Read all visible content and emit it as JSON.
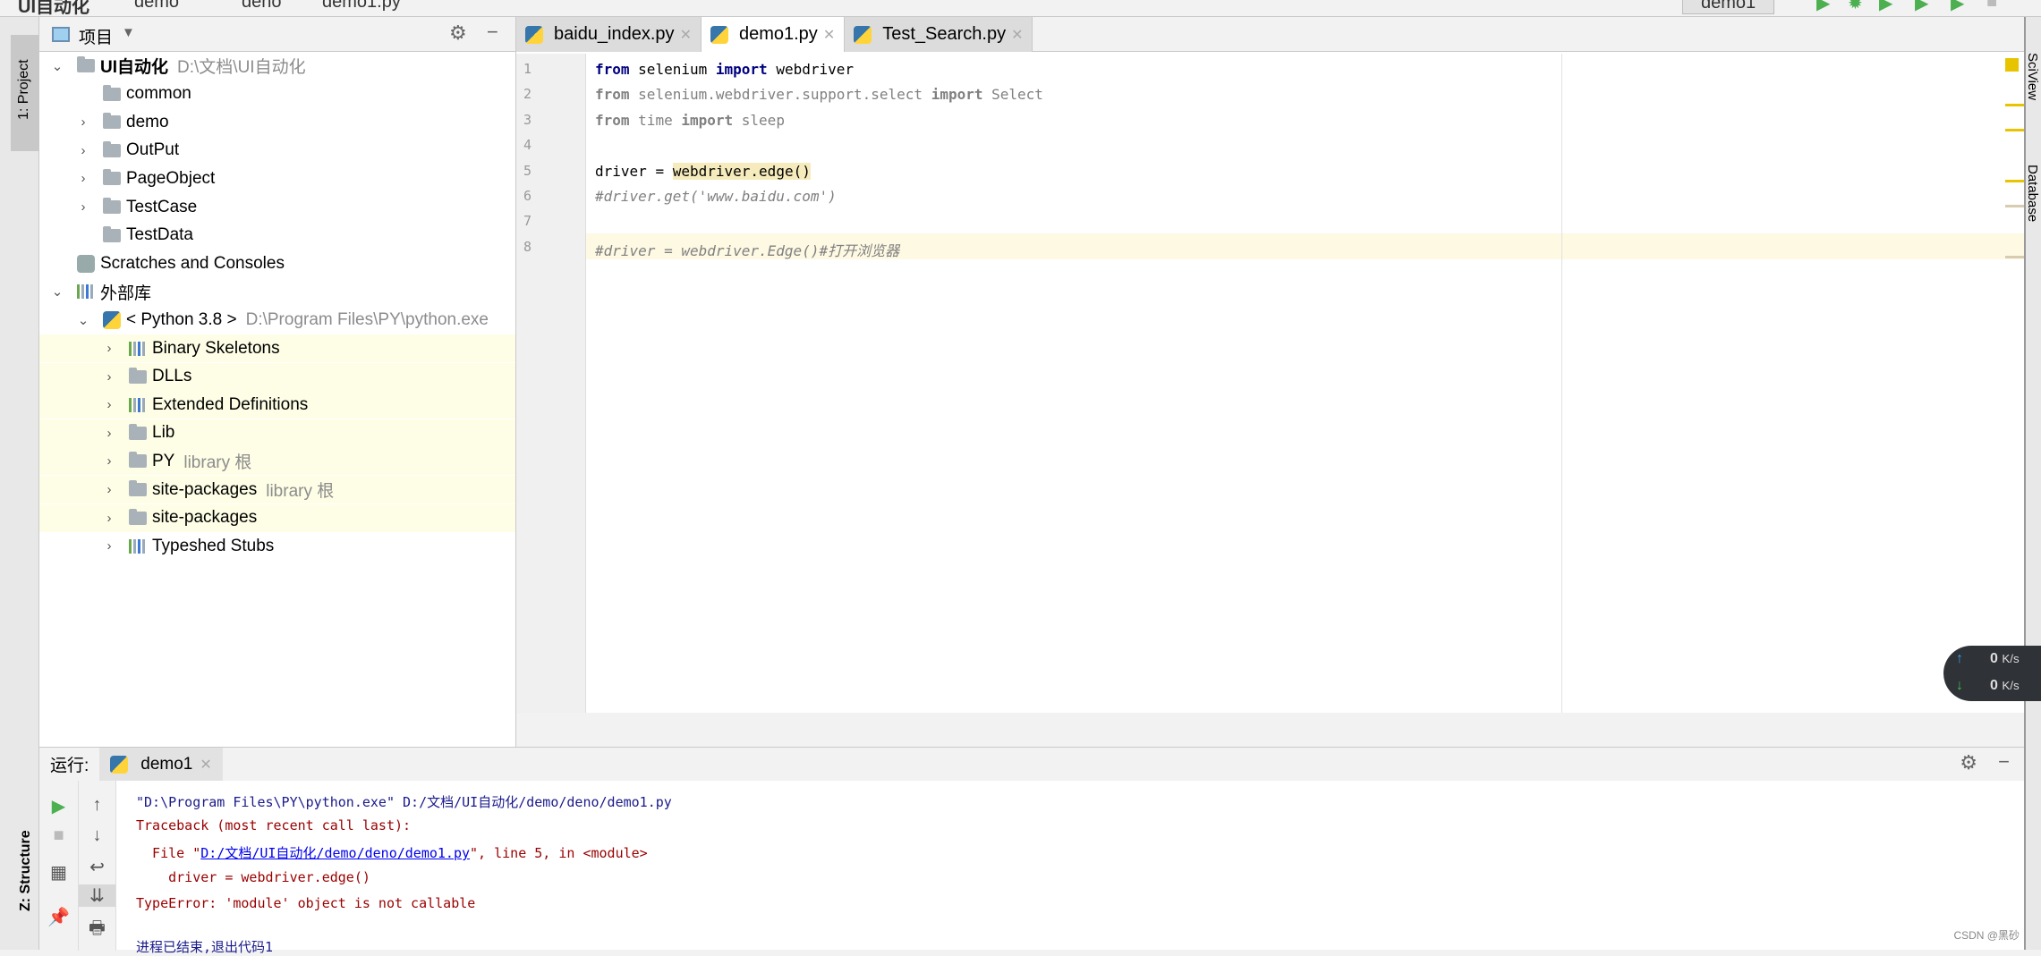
{
  "breadcrumb": [
    "UI自动化",
    "demo",
    "deno",
    "demo1.py"
  ],
  "run_config": "demo1",
  "left_strip": {
    "project_tab": "1: Project",
    "structure_tab": "Z: Structure"
  },
  "right_strip": {
    "sciview_tab": "SciView",
    "database_tab": "Database"
  },
  "project": {
    "title": "项目",
    "tree": [
      {
        "label": "UI自动化",
        "hint": "D:\\文档\\UI自动化",
        "icon": "folder-icon",
        "expanded": true,
        "bold": true,
        "depth": 0
      },
      {
        "label": "common",
        "icon": "folder-icon",
        "depth": 1,
        "leaf": true
      },
      {
        "label": "demo",
        "icon": "folder-icon",
        "depth": 1
      },
      {
        "label": "OutPut",
        "icon": "folder-icon",
        "depth": 1
      },
      {
        "label": "PageObject",
        "icon": "folder-icon",
        "depth": 1
      },
      {
        "label": "TestCase",
        "icon": "folder-icon",
        "depth": 1
      },
      {
        "label": "TestData",
        "icon": "folder-icon",
        "depth": 1,
        "leaf": true
      },
      {
        "label": "Scratches and Consoles",
        "icon": "scratches-icon",
        "depth": 0,
        "leaf": true
      },
      {
        "label": "外部库",
        "icon": "library-icon",
        "depth": 0,
        "expanded": true
      },
      {
        "label": "< Python 3.8 >",
        "hint": "D:\\Program Files\\PY\\python.exe",
        "icon": "python-icon",
        "depth": 1,
        "expanded": true
      },
      {
        "label": "Binary Skeletons",
        "icon": "library-icon",
        "depth": 2,
        "lib": true
      },
      {
        "label": "DLLs",
        "icon": "folder-icon",
        "depth": 2,
        "lib": true
      },
      {
        "label": "Extended Definitions",
        "icon": "library-icon",
        "depth": 2,
        "lib": true
      },
      {
        "label": "Lib",
        "icon": "folder-icon",
        "depth": 2,
        "lib": true
      },
      {
        "label": "PY",
        "hint": "library 根",
        "icon": "folder-icon",
        "depth": 2,
        "lib": true
      },
      {
        "label": "site-packages",
        "hint": "library 根",
        "icon": "folder-icon",
        "depth": 2,
        "lib": true
      },
      {
        "label": "site-packages",
        "icon": "folder-icon",
        "depth": 2,
        "lib": true
      },
      {
        "label": "Typeshed Stubs",
        "icon": "library-icon",
        "depth": 2
      }
    ]
  },
  "editor": {
    "tabs": [
      {
        "label": "baidu_index.py"
      },
      {
        "label": "demo1.py",
        "active": true
      },
      {
        "label": "Test_Search.py"
      }
    ],
    "lines": [
      {
        "n": "1",
        "t": "from selenium import webdriver"
      },
      {
        "n": "2",
        "t": "from selenium.webdriver.support.select import Select"
      },
      {
        "n": "3",
        "t": "from time import sleep"
      },
      {
        "n": "4",
        "t": ""
      },
      {
        "n": "5",
        "t": "driver = webdriver.edge()"
      },
      {
        "n": "6",
        "t": "#driver.get('www.baidu.com')"
      },
      {
        "n": "7",
        "t": ""
      },
      {
        "n": "8",
        "t": "#driver = webdriver.Edge()#打开浏览器"
      }
    ]
  },
  "run": {
    "label": "运行:",
    "tab": "demo1",
    "output": {
      "cmd": "\"D:\\Program Files\\PY\\python.exe\" D:/文档/UI自动化/demo/deno/demo1.py",
      "traceback": "Traceback (most recent call last):",
      "file_prefix": "  File \"",
      "file_link": "D:/文档/UI自动化/demo/deno/demo1.py",
      "file_suffix": "\", line 5, in <module>",
      "code": "    driver = webdriver.edge()",
      "error": "TypeError: 'module' object is not callable",
      "exit": "进程已结束,退出代码1"
    }
  },
  "network": {
    "up": "0",
    "down": "0",
    "unit": "K/s"
  },
  "watermark": "CSDN @黑砂",
  "colors": {
    "keyword": "#000080",
    "error": "#990000",
    "link": "#0000ee",
    "command": "#1a1a8c",
    "run_green": "#4caf50",
    "highlight": "#f6ebbc"
  }
}
